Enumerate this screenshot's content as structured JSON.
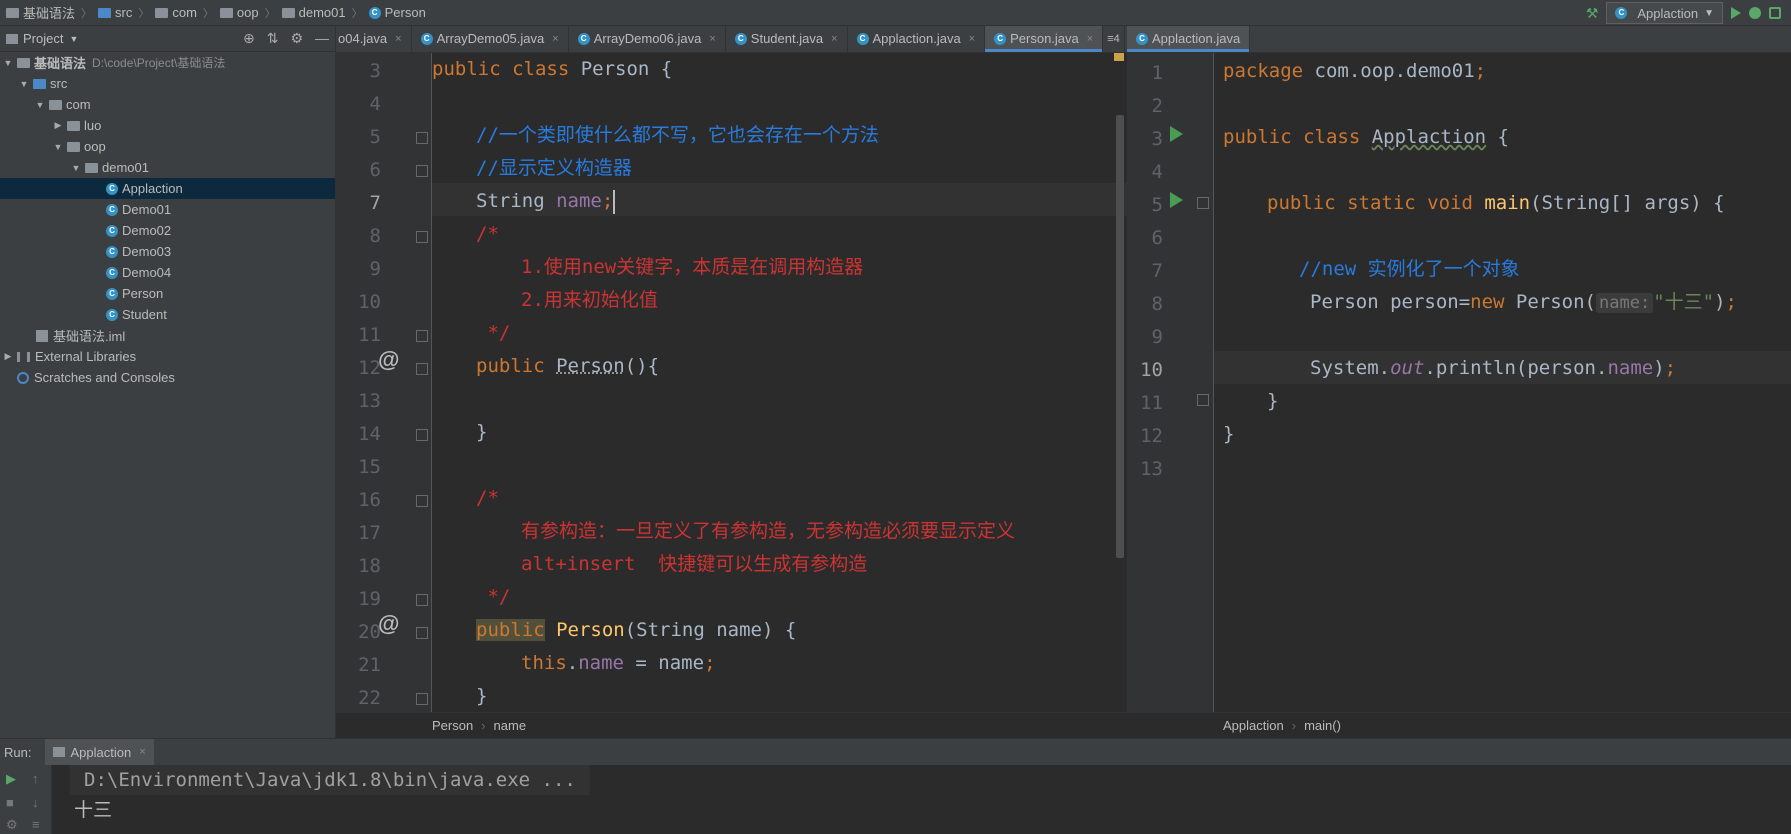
{
  "navbar": {
    "crumbs": [
      "基础语法",
      "src",
      "com",
      "oop",
      "demo01",
      "Person"
    ],
    "run_config": "Applaction"
  },
  "project": {
    "title": "Project",
    "root_name": "基础语法",
    "root_path": "D:\\code\\Project\\基础语法",
    "src": "src",
    "com": "com",
    "luo": "luo",
    "oop": "oop",
    "demo01": "demo01",
    "classes": [
      "Applaction",
      "Demo01",
      "Demo02",
      "Demo03",
      "Demo04",
      "Person",
      "Student"
    ],
    "iml": "基础语法.iml",
    "external_libraries": "External Libraries",
    "scratches": "Scratches and Consoles"
  },
  "left_tabs": [
    "o04.java",
    "ArrayDemo05.java",
    "ArrayDemo06.java",
    "Student.java",
    "Applaction.java",
    "Person.java"
  ],
  "left_tabs_overflow": "≡4",
  "right_tabs": [
    "Applaction.java"
  ],
  "left_editor": {
    "line_numbers": [
      "3",
      "4",
      "5",
      "6",
      "7",
      "8",
      "9",
      "10",
      "11",
      "12",
      "13",
      "14",
      "15",
      "16",
      "17",
      "18",
      "19",
      "20",
      "21",
      "22"
    ],
    "tokens": {
      "l3_kw": "public class ",
      "l3_cls": "Person",
      "l3_rest": " {",
      "l5": "//一个类即使什么都不写，它也会存在一个方法",
      "l6": "//显示定义构造器",
      "l7_type": "String ",
      "l7_name": "name",
      "l7_semi": ";",
      "l8": "/*",
      "l9": "1.使用new关键字，本质是在调用构造器",
      "l10": "2.用来初始化值",
      "l11": " */",
      "l12_kw": "public ",
      "l12_name": "Person",
      "l12_rest": "(){",
      "l14": "}",
      "l16": "/*",
      "l17": "有参构造：一旦定义了有参构造，无参构造必须要显示定义",
      "l18": "alt+insert  快捷键可以生成有参构造",
      "l19": " */",
      "l20_kw": "public",
      "l20_name": " Person",
      "l20_rest": "(String name) {",
      "l21_this": "this",
      "l21_dot": ".",
      "l21_fld": "name",
      "l21_rest": " = name",
      "l21_semi": ";",
      "l22": "}"
    },
    "annotation_symbol": "@",
    "breadcrumb": [
      "Person",
      "name"
    ]
  },
  "right_editor": {
    "line_numbers": [
      "1",
      "2",
      "3",
      "4",
      "5",
      "6",
      "7",
      "8",
      "9",
      "10",
      "11",
      "12",
      "13"
    ],
    "tokens": {
      "l1_kw": "package ",
      "l1_pkg": "com.oop.demo01",
      "l1_semi": ";",
      "l3_kw": "public class ",
      "l3_cls": "Applaction",
      "l3_rest": " {",
      "l5_kw": "public static void ",
      "l5_name": "main",
      "l5_rest": "(String[] args) {",
      "l7": "//new 实例化了一个对象",
      "l8_a": "Person person=",
      "l8_new": "new",
      "l8_b": " Person(",
      "l8_hint": "name:",
      "l8_str": "\"十三\"",
      "l8_c": ")",
      "l8_semi": ";",
      "l10_a": "System.",
      "l10_out": "out",
      "l10_b": ".println(person.",
      "l10_fld": "name",
      "l10_c": ")",
      "l10_semi": ";",
      "l11": "}",
      "l12": "}"
    },
    "breadcrumb": [
      "Applaction",
      "main()"
    ]
  },
  "run": {
    "label": "Run:",
    "tab": "Applaction",
    "console": [
      "D:\\Environment\\Java\\jdk1.8\\bin\\java.exe ...",
      "十三"
    ]
  },
  "colors": {
    "keyword": "#cc7832",
    "class_name": "#ffc66d",
    "field": "#9876aa",
    "comment_blue": "#287bde",
    "comment_red": "#cc3333",
    "string": "#6a8759"
  }
}
